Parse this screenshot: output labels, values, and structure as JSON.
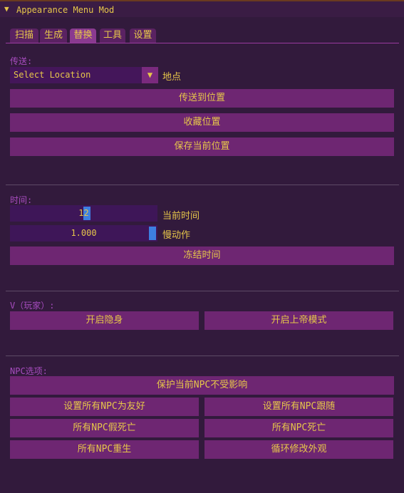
{
  "window": {
    "title": "Appearance Menu Mod",
    "collapse_icon": "triangle-down-icon"
  },
  "tabs": [
    {
      "label": "扫描",
      "active": false
    },
    {
      "label": "生成",
      "active": false
    },
    {
      "label": "替换",
      "active": true
    },
    {
      "label": "工具",
      "active": false
    },
    {
      "label": "设置",
      "active": false
    }
  ],
  "teleport": {
    "section_label": "传送:",
    "location_select": {
      "value": "Select Location",
      "side_label": "地点"
    },
    "buttons": [
      "传送到位置",
      "收藏位置",
      "保存当前位置"
    ]
  },
  "time": {
    "section_label": "时间:",
    "current_time": {
      "value": "12",
      "fraction": 0.5,
      "label": "当前时间"
    },
    "slow_motion": {
      "value": "1.000",
      "fraction": 1.0,
      "label": "慢动作"
    },
    "freeze_button": "冻结时间"
  },
  "player": {
    "section_label": "V（玩家）:",
    "buttons": [
      "开启隐身",
      "开启上帝模式"
    ]
  },
  "npc": {
    "section_label": "NPC选项:",
    "buttons": [
      "保护当前NPC不受影响",
      "设置所有NPC为友好",
      "设置所有NPC跟随",
      "所有NPC假死亡",
      "所有NPC死亡",
      "所有NPC重生",
      "循环修改外观"
    ]
  },
  "colors": {
    "text": "#e6c64a",
    "label": "#a84cc0",
    "button": "#6e2672",
    "slider_grab": "#3d7fe0",
    "active_tab": "#8a3a90"
  }
}
